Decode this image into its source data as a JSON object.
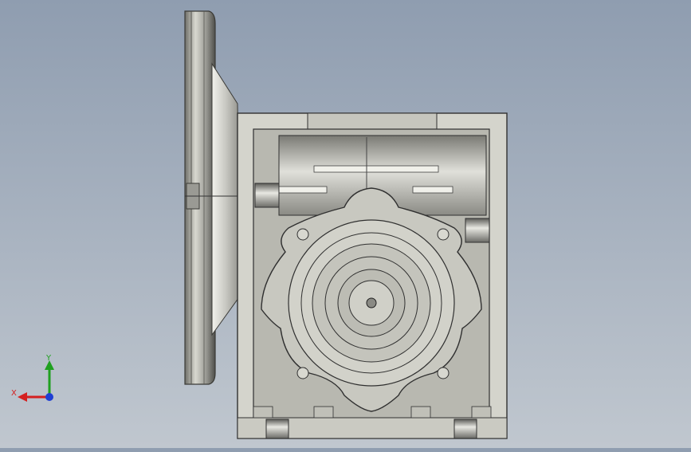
{
  "viewport": {
    "background_top": "#8f9db0",
    "background_bottom": "#c0c7cf"
  },
  "model": {
    "part": "worm-gear-reducer",
    "view": "front"
  },
  "triad": {
    "x_label": "X",
    "y_label": "Y",
    "x_color": "#d42020",
    "y_color": "#1fa01f",
    "z_color": "#1f3fd4"
  }
}
